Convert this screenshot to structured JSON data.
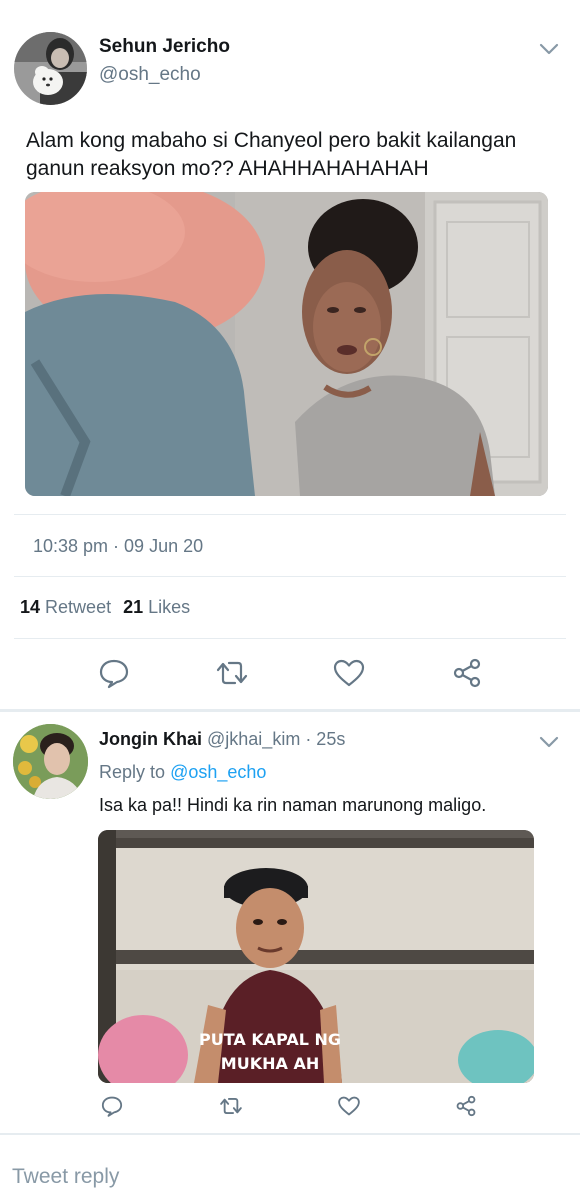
{
  "tweet": {
    "author_name": "Sehun Jericho",
    "author_handle": "@osh_echo",
    "text": "Alam kong mabaho si Chanyeol pero bakit kailangan ganun reaksyon mo?? AHAHHAHAHAHAH",
    "timestamp": "10:38 pm · 09 Jun 20",
    "retweet_count": "14",
    "retweet_label": "Retweet",
    "likes_count": "21",
    "likes_label": "Likes"
  },
  "reply": {
    "author_name": "Jongin Khai",
    "meta": "@jkhai_kim · 25s",
    "reply_to_label": "Reply to",
    "reply_to_handle": "@osh_echo",
    "text": "Isa ka pa!! Hindi ka rin naman marunong maligo.",
    "media_caption_line1": "PUTA KAPAL NG",
    "media_caption_line2": "MUKHA AH"
  },
  "composer": {
    "placeholder": "Tweet reply"
  },
  "icons": {
    "reply": "speech-bubble-icon",
    "retweet": "retweet-icon",
    "like": "heart-icon",
    "share": "share-icon",
    "more": "chevron-down-icon"
  },
  "colors": {
    "text": "#14171a",
    "secondary": "#657786",
    "link": "#1da1f2",
    "divider": "#e6ecf0",
    "placeholder": "#8899a6"
  }
}
